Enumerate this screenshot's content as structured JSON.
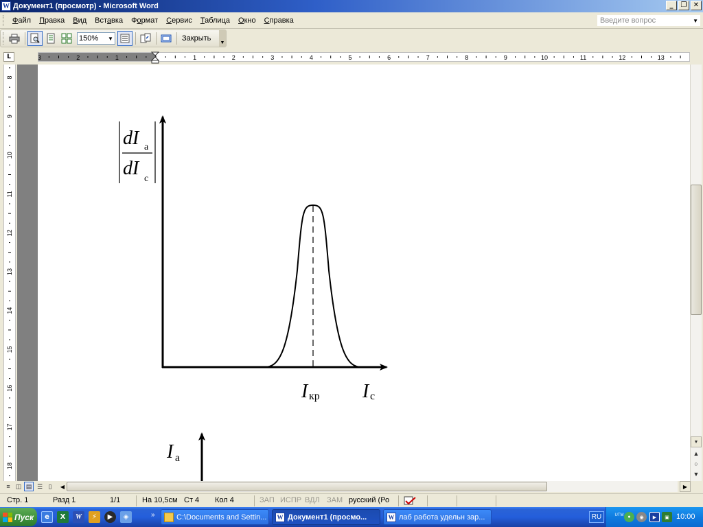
{
  "window": {
    "title": "Документ1 (просмотр) - Microsoft Word",
    "app_icon": "W",
    "minimize": "_",
    "restore": "❐",
    "close": "✕"
  },
  "menu": {
    "items": [
      {
        "pre": "",
        "key": "Ф",
        "post": "айл"
      },
      {
        "pre": "",
        "key": "П",
        "post": "равка"
      },
      {
        "pre": "",
        "key": "В",
        "post": "ид"
      },
      {
        "pre": "Вст",
        "key": "а",
        "post": "вка"
      },
      {
        "pre": "Ф",
        "key": "о",
        "post": "рмат"
      },
      {
        "pre": "",
        "key": "С",
        "post": "ервис"
      },
      {
        "pre": "",
        "key": "Т",
        "post": "аблица"
      },
      {
        "pre": "",
        "key": "О",
        "post": "кно"
      },
      {
        "pre": "",
        "key": "С",
        "post": "правка"
      }
    ],
    "help_placeholder": "Введите вопрос"
  },
  "toolbar": {
    "zoom": "150%",
    "close_label": "Закрыть"
  },
  "ruler": {
    "horizontal_left_labels": [
      "3",
      "2",
      "1"
    ],
    "horizontal_right_labels": [
      "1",
      "2",
      "3",
      "4",
      "5",
      "6",
      "7",
      "8",
      "9",
      "10",
      "11",
      "12",
      "13"
    ],
    "vertical_labels": [
      "8",
      "9",
      "10",
      "11",
      "12",
      "13",
      "14",
      "15",
      "16",
      "17",
      "18"
    ]
  },
  "document": {
    "graph1": {
      "y_label_num_d": "d",
      "y_label_num_I": "I",
      "y_label_num_sub": "а",
      "y_label_den_d": "d",
      "y_label_den_I": "I",
      "y_label_den_sub": "с",
      "peak_label_I": "I",
      "peak_label_sub": "кр",
      "x_label_I": "I",
      "x_label_sub": "с"
    },
    "graph2": {
      "y_label_I": "I",
      "y_label_sub": "а"
    }
  },
  "status": {
    "page": "Стр. 1",
    "section": "Разд 1",
    "pages": "1/1",
    "at": "На 10,5см",
    "line": "Ст 4",
    "col": "Кол 4",
    "rec": "ЗАП",
    "trk": "ИСПР",
    "ext": "ВДЛ",
    "ovr": "ЗАМ",
    "language": "русский (Ро"
  },
  "taskbar": {
    "start": "Пуск",
    "tasks": [
      {
        "label": "C:\\Documents and Settin...",
        "active": false
      },
      {
        "label": "Документ1 (просмо...",
        "active": true
      },
      {
        "label": "лаб работа удельн зар...",
        "active": false
      }
    ],
    "lang": "RU",
    "clock": "10:00",
    "tray_utm": "UTM"
  },
  "colors": {
    "titlebar_start": "#0a246a",
    "titlebar_end": "#a6caf0",
    "chrome": "#ece9d8",
    "taskbar_blue": "#245edb",
    "start_green": "#3c8f3a"
  }
}
